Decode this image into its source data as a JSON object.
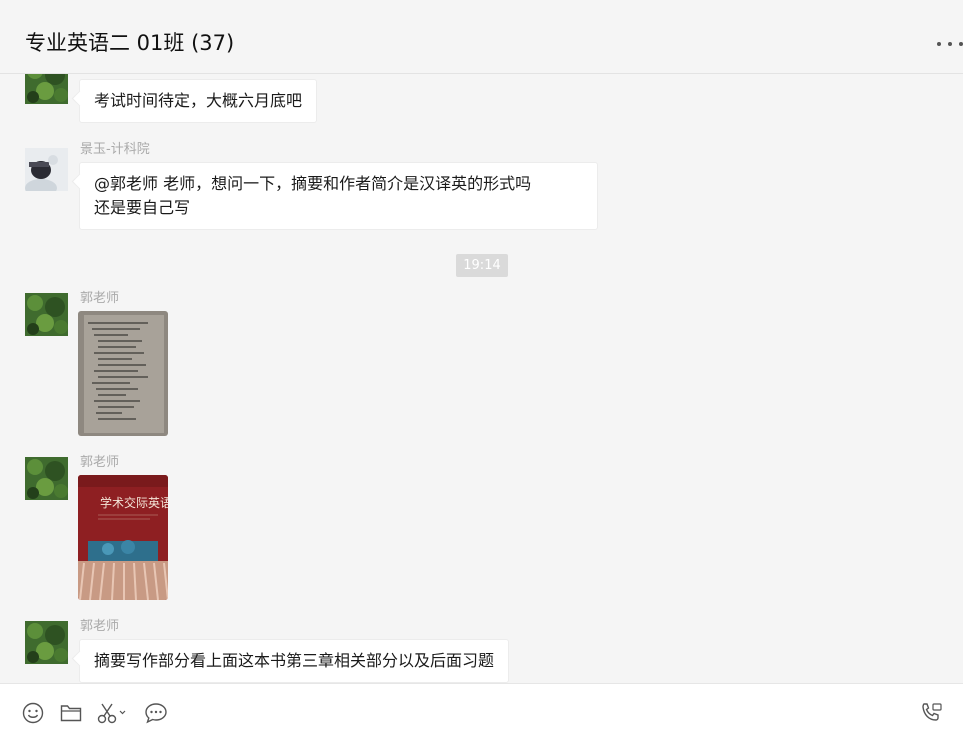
{
  "window": {
    "title": "专业英语二 01班 (37)",
    "controls": [
      "pin-icon",
      "minimize-icon",
      "maximize-icon",
      "close-icon"
    ]
  },
  "messages": [
    {
      "sender": "",
      "text": "考试时间待定，大概六月底吧"
    },
    {
      "sender": "景玉-计科院",
      "lines": [
        "@郭老师 老师，想问一下，摘要和作者简介是汉译英的形式吗",
        "还是要自己写"
      ]
    },
    {
      "timestamp": "19:14"
    },
    {
      "sender": "郭老师",
      "image": "document-photo"
    },
    {
      "sender": "郭老师",
      "image": "book-cover-photo",
      "image_text": "学术交际英语"
    },
    {
      "sender": "郭老师",
      "text": "摘要写作部分看上面这本书第三章相关部分以及后面习题"
    }
  ],
  "toolbar": {
    "icons": [
      "emoji-icon",
      "folder-icon",
      "scissors-icon",
      "chat-history-icon",
      "voice-call-icon"
    ]
  },
  "colors": {
    "background": "#f5f5f5",
    "bubble": "#ffffff",
    "timestamp_bg": "#dadada",
    "sender": "#a9a9a9"
  }
}
